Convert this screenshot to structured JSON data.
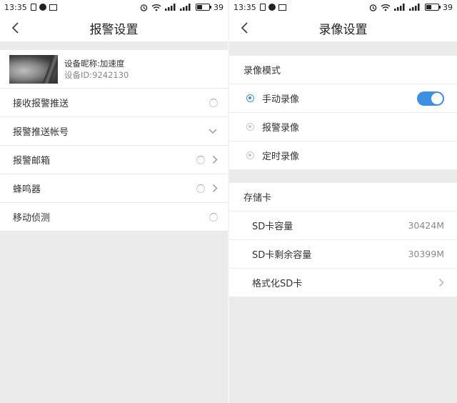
{
  "left": {
    "status": {
      "time": "13:35",
      "battery": "39",
      "battery_level": 0.39
    },
    "title": "报警设置",
    "device": {
      "nickname": "设备昵称:加速度",
      "id": "设备ID:9242130"
    },
    "rows": [
      {
        "label": "接收报警推送"
      },
      {
        "label": "报警推送帐号"
      },
      {
        "label": "报警邮箱"
      },
      {
        "label": "蜂鸣器"
      },
      {
        "label": "移动侦测"
      }
    ]
  },
  "right": {
    "status": {
      "time": "13:35",
      "battery": "39",
      "battery_level": 0.39
    },
    "title": "录像设置",
    "record_mode": {
      "header": "录像模式",
      "options": [
        {
          "label": "手动录像",
          "selected": true,
          "toggle_on": true
        },
        {
          "label": "报警录像",
          "selected": false
        },
        {
          "label": "定时录像",
          "selected": false
        }
      ]
    },
    "storage": {
      "header": "存储卡",
      "capacity_label": "SD卡容量",
      "capacity_value": "30424M",
      "remaining_label": "SD卡剩余容量",
      "remaining_value": "30399M",
      "format_label": "格式化SD卡"
    }
  },
  "colors": {
    "accent": "#3d8fe0",
    "background": "#ebebeb"
  }
}
